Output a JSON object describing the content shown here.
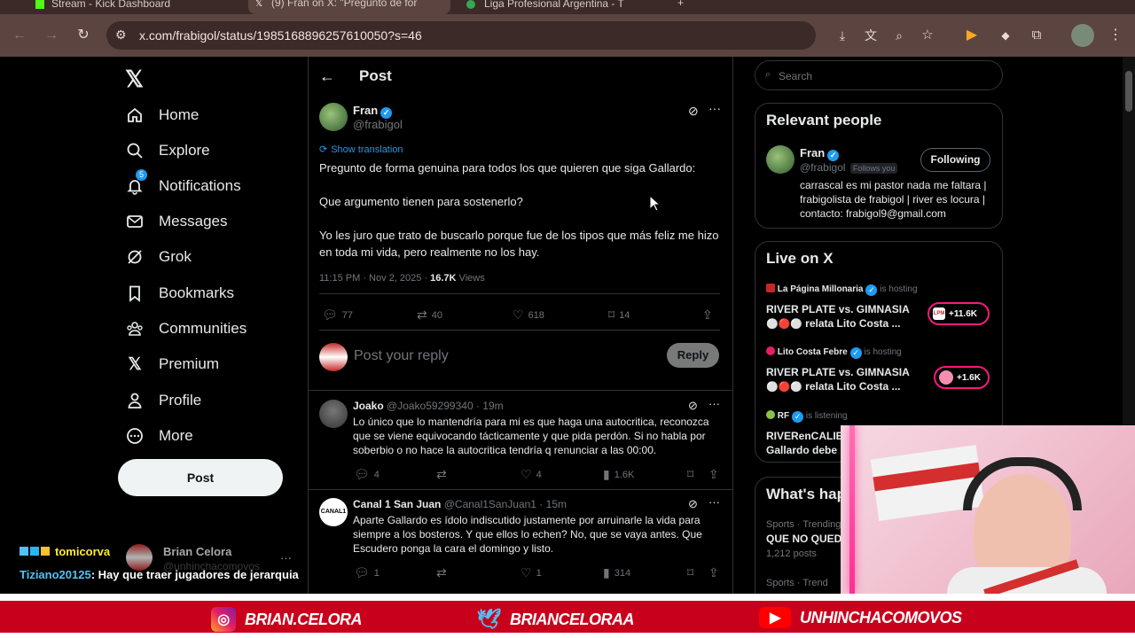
{
  "browser": {
    "tabs": [
      {
        "label": "Stream - Kick Dashboard"
      },
      {
        "label": "(9) Fran on X: \"Pregunto de for"
      },
      {
        "label": "Liga Profesional Argentina - T"
      }
    ],
    "url": "x.com/frabigol/status/1985168896257610050?s=46"
  },
  "nav": {
    "items": [
      {
        "label": "Home"
      },
      {
        "label": "Explore"
      },
      {
        "label": "Notifications",
        "badge": "5"
      },
      {
        "label": "Messages"
      },
      {
        "label": "Grok"
      },
      {
        "label": "Bookmarks"
      },
      {
        "label": "Communities"
      },
      {
        "label": "Premium"
      },
      {
        "label": "Profile"
      },
      {
        "label": "More"
      }
    ],
    "post_button": "Post"
  },
  "header": {
    "title": "Post"
  },
  "tweet": {
    "author": "Fran",
    "handle": "@frabigol",
    "show_translation": "Show translation",
    "line1": "Pregunto de forma genuina para todos los que quieren que siga Gallardo:",
    "line2": "Que argumento tienen para sostenerlo?",
    "line3": "Yo les juro que trato de buscarlo porque fue de los tipos que más feliz me hizo en toda mi vida, pero realmente no los hay.",
    "time": "11:15 PM · Nov 2, 2025 · ",
    "views_count": "16.7K",
    "views_label": " Views",
    "replies": "77",
    "reposts": "40",
    "likes": "618",
    "bookmarks": "14"
  },
  "reply_box": {
    "placeholder": "Post your reply",
    "button": "Reply"
  },
  "replies": [
    {
      "name": "Joako",
      "meta": "@Joako59299340 · 19m",
      "text": "Lo único que lo mantendría para mi es que haga una autocritica, reconozca que se viene equivocando tácticamente y que pida perdón. Si no habla por soberbio o no hace la autocritica tendría q renunciar a las 00:00.",
      "replies": "4",
      "likes": "4",
      "views": "1.6K"
    },
    {
      "name": "Canal 1 San Juan",
      "meta": "@Canal1SanJuan1 · 15m",
      "text": "Aparte Gallardo es ídolo indiscutido justamente por arruinarle la vida para siempre a los bosteros. Y que ellos lo echen? No, que se vaya antes. Que Escudero ponga la cara el domingo y listo.",
      "replies": "1",
      "likes": "1",
      "views": "314",
      "avatar_text": "CANAL1"
    }
  ],
  "sidebar": {
    "search_placeholder": "Search",
    "relevant_title": "Relevant people",
    "person": {
      "name": "Fran",
      "handle": "@frabigol",
      "follows_you": "Follows you",
      "button": "Following",
      "bio": "carrascal es mi pastor nada me faltara | frabigolista de frabigol | river es locura | contacto: frabigol9@gmail.com"
    },
    "live_title": "Live on X",
    "live": [
      {
        "host": "La Página Millonaria",
        "status": "is hosting",
        "title1": "RIVER PLATE vs. GIMNASIA",
        "title2": "relata Lito Costa ...",
        "count": "+11.6K"
      },
      {
        "host": "Lito Costa Febre",
        "status": "is hosting",
        "title1": "RIVER PLATE vs. GIMNASIA",
        "title2": "relata Lito Costa ...",
        "count": "+1.6K"
      },
      {
        "host": "RF",
        "status": "is listening",
        "title1": "RIVERenCALIE",
        "title2": "Gallardo debe i"
      }
    ],
    "happening_title": "What's hap",
    "trends": [
      {
        "meta": "Sports · Trending",
        "title": "QUE NO QUED",
        "posts": "1,212 posts"
      },
      {
        "meta": "Sports · Trend"
      }
    ]
  },
  "stream_overlay": {
    "chat": [
      {
        "user": "tomicorva",
        "text": ""
      },
      {
        "user": "Tiziano20125",
        "text": ": Hay que traer jugadores de jerarquia"
      }
    ],
    "behind_name": "Brian Celora",
    "behind_handle": "@unhinchacomovos",
    "socials": [
      {
        "platform": "instagram-icon",
        "handle": "BRIAN.CELORA"
      },
      {
        "platform": "twitter-icon",
        "handle": "BRIANCELORAA"
      },
      {
        "platform": "youtube-icon",
        "handle": "UNHINCHACOMOVOS"
      }
    ]
  },
  "colors": {
    "accent": "#1d9bf0",
    "border": "#2f3336",
    "overlay_red": "#c9001c",
    "live_pink": "#f91880"
  }
}
